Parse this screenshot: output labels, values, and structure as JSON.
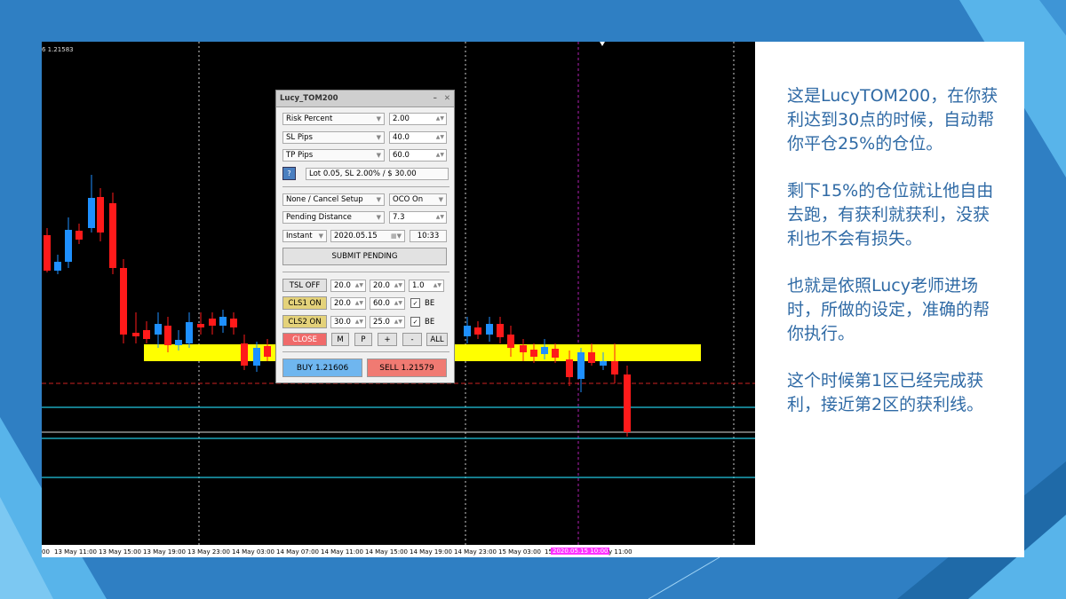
{
  "chart": {
    "price_top": "6 1.21583",
    "time_axis": [
      "00",
      "13 May 11:00",
      "13 May 15:00",
      "13 May 19:00",
      "13 May 23:00",
      "14 May 03:00",
      "14 May 07:00",
      "14 May 11:00",
      "14 May 15:00",
      "14 May 19:00",
      "14 May 23:00",
      "15 May 03:00",
      "15",
      "2020.05.15 10:00",
      "y 11:00"
    ],
    "colors": {
      "bull": "#1e90ff",
      "bear": "#ff1a1a",
      "zone": "#ffff00",
      "level": "#22c6e0",
      "cursor": "#b020b0"
    }
  },
  "panel": {
    "title": "Lucy_TOM200",
    "risk_label": "Risk Percent",
    "risk_value": "2.00",
    "sl_label": "SL Pips",
    "sl_value": "40.0",
    "tp_label": "TP Pips",
    "tp_value": "60.0",
    "help_icon": "?",
    "lot_info": "Lot 0.05, SL 2.00% / $ 30.00",
    "setup_label": "None / Cancel Setup",
    "oco_label": "OCO On",
    "pending_label": "Pending Distance",
    "pending_value": "7.3",
    "exec_label": "Instant",
    "date_value": "2020.05.15",
    "time_value": "10:33",
    "submit_label": "SUBMIT PENDING",
    "tsl_label": "TSL OFF",
    "tsl_v1": "20.0",
    "tsl_v2": "20.0",
    "tsl_v3": "1.0",
    "cls1_label": "CLS1 ON",
    "cls1_v1": "20.0",
    "cls1_v2": "60.0",
    "cls2_label": "CLS2 ON",
    "cls2_v1": "30.0",
    "cls2_v2": "25.0",
    "be_label": "BE",
    "check_mark": "✓",
    "close_label": "CLOSE",
    "m_label": "M",
    "p_label": "P",
    "plus_label": "+",
    "minus_label": "-",
    "all_label": "ALL",
    "buy_label": "BUY 1.21606",
    "sell_label": "SELL 1.21579"
  },
  "text": {
    "p1": "这是LucyTOM200，在你获利达到30点的时候，自动帮你平仓25%的仓位。",
    "p2": "剩下15%的仓位就让他自由去跑，有获利就获利，没获利也不会有损失。",
    "p3": "也就是依照Lucy老师进场时，所做的设定，准确的帮你执行。",
    "p4": "这个时候第1区已经完成获利，接近第2区的获利线。"
  }
}
